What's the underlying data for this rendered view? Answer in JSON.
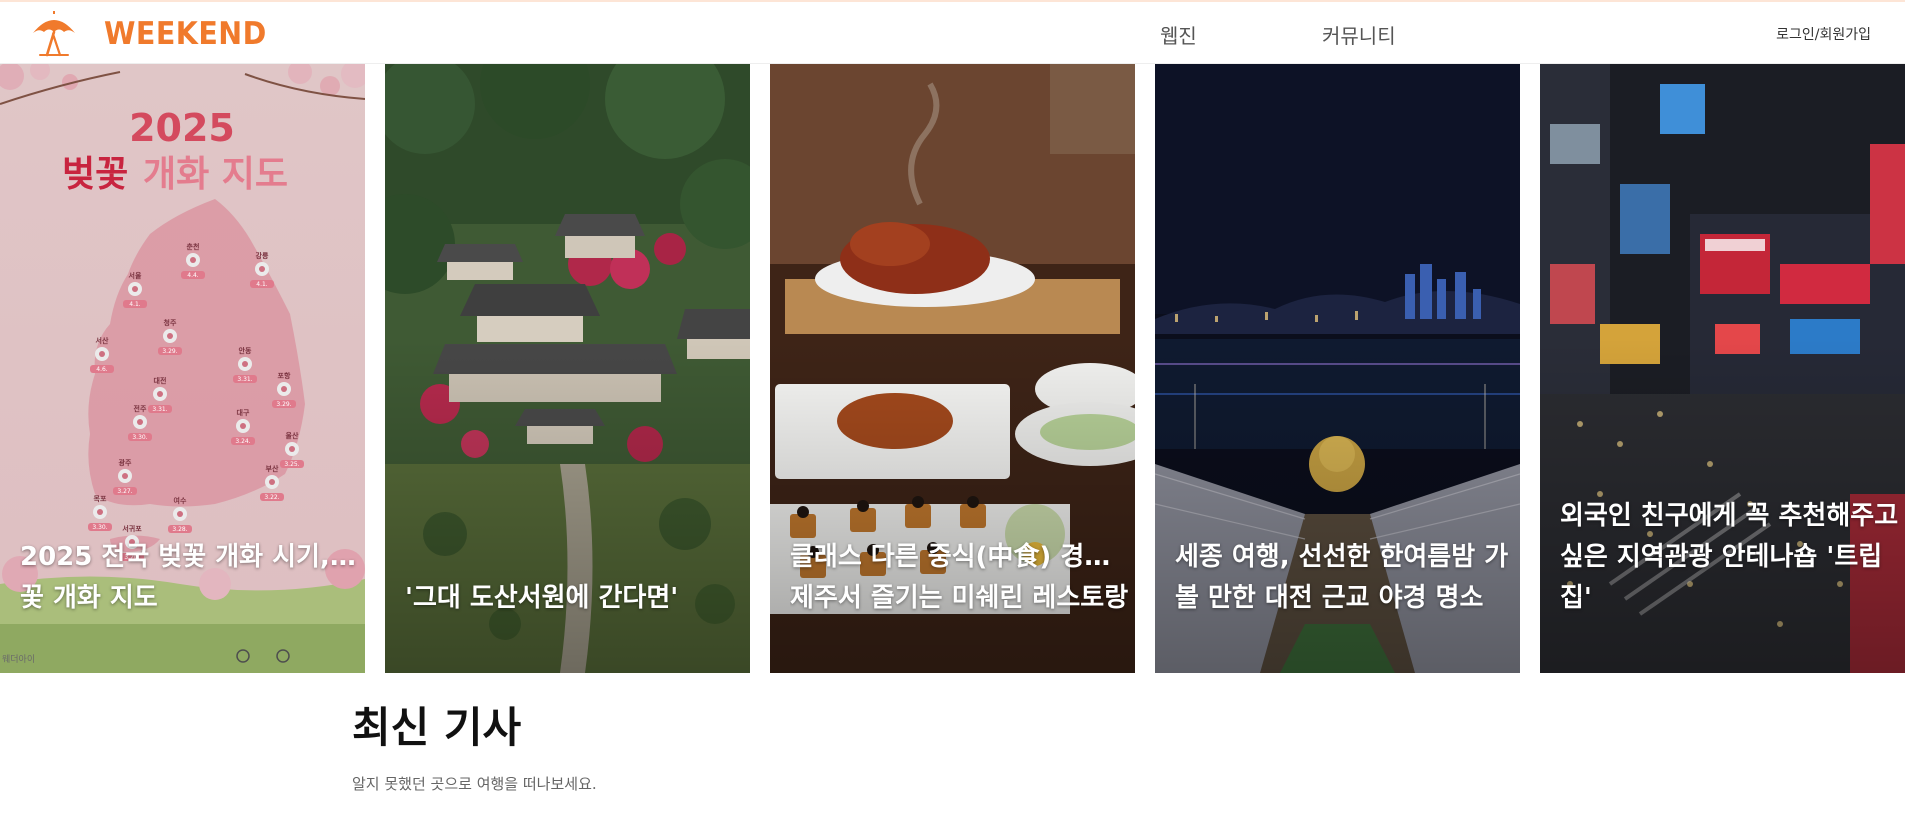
{
  "header": {
    "logo_text": "WEEKEND",
    "logo_icon": "umbrella-icon",
    "brand_color": "#f07a2c",
    "nav": [
      {
        "label": "웹진"
      },
      {
        "label": "커뮤니티"
      }
    ],
    "auth_label": "로그인/회원가입"
  },
  "carousel": {
    "cards": [
      {
        "title_lines": [
          "2025 전국 벚꽃 개화 시기, 벚",
          "꽃 개화 지도"
        ],
        "image_year": "2025",
        "image_heading_a": "벚꽃",
        "image_heading_b": "개화 지도",
        "credit": "웨더아이",
        "map_markers": [
          {
            "city": "춘천",
            "date": "4.4."
          },
          {
            "city": "강릉",
            "date": "4.1."
          },
          {
            "city": "서울",
            "date": "4.1."
          },
          {
            "city": "청주",
            "date": "3.29."
          },
          {
            "city": "서산",
            "date": "4.6."
          },
          {
            "city": "안동",
            "date": "3.31."
          },
          {
            "city": "포항",
            "date": "3.29."
          },
          {
            "city": "대전",
            "date": "3.31."
          },
          {
            "city": "대구",
            "date": "3.24."
          },
          {
            "city": "전주",
            "date": "3.30."
          },
          {
            "city": "울산",
            "date": "3.25."
          },
          {
            "city": "광주",
            "date": "3.27."
          },
          {
            "city": "부산",
            "date": "3.22."
          },
          {
            "city": "목포",
            "date": "3.30."
          },
          {
            "city": "여수",
            "date": "3.28."
          },
          {
            "city": "서귀포",
            "date": "3.20."
          }
        ]
      },
      {
        "title_lines": [
          "'그대 도산서원에 간다면'"
        ]
      },
      {
        "title_lines": [
          "클래스 다른 중식(中食) 경험…",
          "제주서 즐기는 미쉐린 레스토랑"
        ]
      },
      {
        "title_lines": [
          "세종 여행, 선선한 한여름밤 가",
          "볼 만한 대전 근교 야경 명소"
        ]
      },
      {
        "title_lines": [
          "외국인 친구에게 꼭 추천해주고",
          "싶은 지역관광 안테나숍 '트립",
          "집'"
        ]
      }
    ]
  },
  "latest": {
    "title": "최신 기사",
    "subtitle": "알지 못했던 곳으로 여행을 떠나보세요."
  }
}
